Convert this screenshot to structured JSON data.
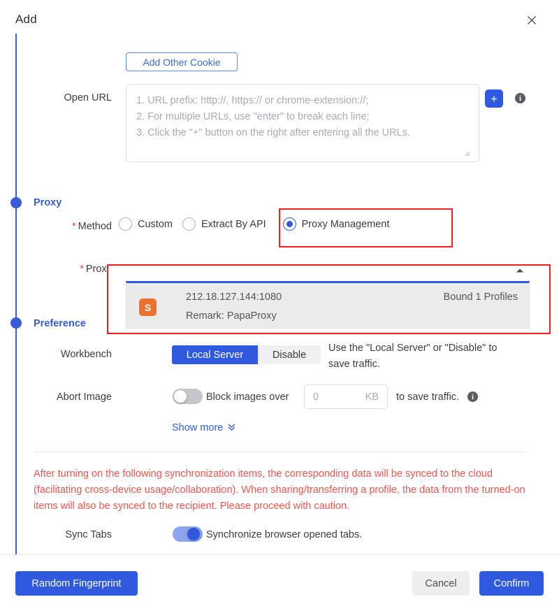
{
  "header": {
    "title": "Add",
    "close_icon": "close-icon"
  },
  "cookie": {
    "add_other_label": "Add Other Cookie"
  },
  "open_url": {
    "label": "Open URL",
    "placeholder": "1. URL prefix: http://, https:// or chrome-extension://;\n2. For multiple URLs, use \"enter\" to break each line;\n3. Click the \"+\" button on the right after entering all the URLs.",
    "value": "",
    "add_button_label": "+",
    "info_icon": "info-icon",
    "info_glyph": "i",
    "resize_grip": "⟋"
  },
  "proxy_section": {
    "heading": "Proxy",
    "method": {
      "label": "Method",
      "required": "*",
      "options": [
        {
          "label": "Custom",
          "selected": false
        },
        {
          "label": "Extract By API",
          "selected": false
        },
        {
          "label": "Proxy Management",
          "selected": true
        }
      ],
      "selected_value": "Proxy Management",
      "highlighted": true
    },
    "proxy": {
      "label": "Proxy",
      "required": "*",
      "collapse_icon": "caret-up-icon",
      "collapse_glyph": "▲",
      "highlighted": true,
      "selected_item": {
        "badge": "S",
        "badge_icon": "socks-proxy-icon",
        "address": "212.18.127.144:1080",
        "remark": "Remark: PapaProxy",
        "bound": "Bound 1 Profiles"
      }
    }
  },
  "preference_section": {
    "heading": "Preference",
    "workbench": {
      "label": "Workbench",
      "options": [
        {
          "label": "Local Server",
          "active": true
        },
        {
          "label": "Disable",
          "active": false
        }
      ],
      "hint": "Use the \"Local Server\" or \"Disable\" to save traffic."
    },
    "abort_image": {
      "label": "Abort Image",
      "toggle_state": "off",
      "text_before": "Block images over",
      "input_value": "0",
      "input_placeholder": "0",
      "input_unit": "KB",
      "text_after": "to save traffic.",
      "info_icon": "info-icon",
      "info_glyph": "i"
    },
    "show_more": {
      "label": "Show more",
      "chevron_icon": "chevron-double-down-icon",
      "chevron_glyph": "⌄"
    }
  },
  "sync_section": {
    "warning": "After turning on the following synchronization items, the corresponding data will be synced to the cloud (facilitating cross-device usage/collaboration). When sharing/transferring a profile, the data from the turned-on items will also be synced to the recipient. Please proceed with caution.",
    "sync_tabs": {
      "label": "Sync Tabs",
      "toggle_state": "on",
      "description": "Synchronize browser opened tabs."
    }
  },
  "footer": {
    "random_fingerprint": "Random Fingerprint",
    "cancel": "Cancel",
    "confirm": "Confirm"
  },
  "colors": {
    "accent_blue": "#2f5ae0",
    "rail_blue": "#3a5bd9",
    "highlight_red": "#fb1c1c",
    "warning_red": "#f2554f",
    "badge_orange": "#ef7130",
    "required_red": "#f24a45"
  }
}
